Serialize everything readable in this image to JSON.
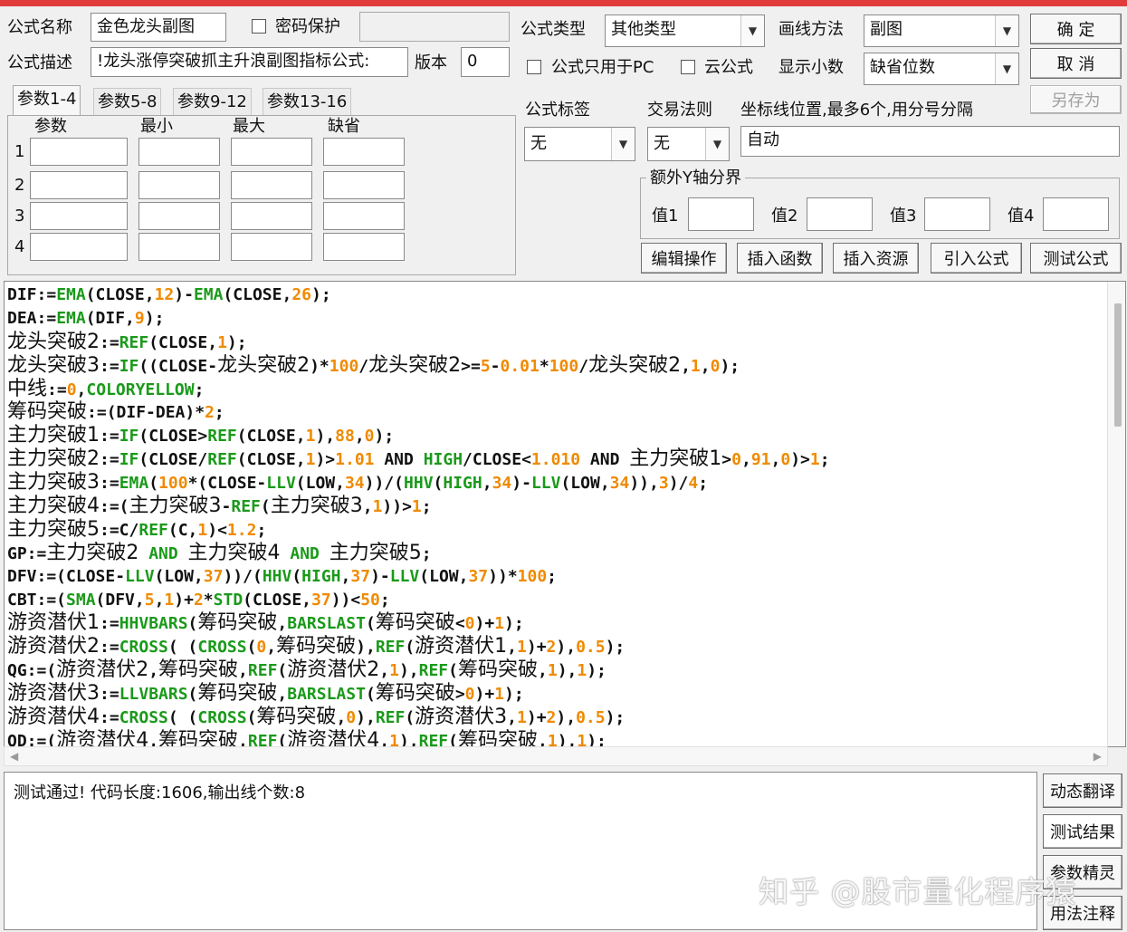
{
  "header": {
    "name_label": "公式名称",
    "name_value": "金色龙头副图",
    "password_label": "密码保护",
    "desc_label": "公式描述",
    "desc_value": "!龙头涨停突破抓主升浪副图指标公式:",
    "version_label": "版本",
    "version_value": "0",
    "type_label": "公式类型",
    "type_value": "其他类型",
    "draw_label": "画线方法",
    "draw_value": "副图",
    "pc_only_label": "公式只用于PC",
    "cloud_label": "云公式",
    "decimal_label": "显示小数",
    "decimal_value": "缺省位数"
  },
  "buttons": {
    "ok": "确  定",
    "cancel": "取  消",
    "save_as": "另存为",
    "edit": "编辑操作",
    "insert_func": "插入函数",
    "insert_res": "插入资源",
    "import": "引入公式",
    "test": "测试公式"
  },
  "tabs": [
    "参数1-4",
    "参数5-8",
    "参数9-12",
    "参数13-16"
  ],
  "params": {
    "headers": [
      "参数",
      "最小",
      "最大",
      "缺省"
    ],
    "rows": [
      "1",
      "2",
      "3",
      "4"
    ]
  },
  "meta": {
    "tag_label": "公式标签",
    "tag_value": "无",
    "rule_label": "交易法则",
    "rule_value": "无",
    "coord_label": "坐标线位置,最多6个,用分号分隔",
    "coord_value": "自动",
    "yaxis_title": "额外Y轴分界",
    "y_labels": [
      "值1",
      "值2",
      "值3",
      "值4"
    ]
  },
  "code": [
    [
      [
        "DIF:=",
        ""
      ],
      [
        "EMA",
        "fn"
      ],
      [
        "(CLOSE,",
        ""
      ],
      [
        "12",
        "num"
      ],
      [
        ")-",
        ""
      ],
      [
        "EMA",
        "fn"
      ],
      [
        "(CLOSE,",
        ""
      ],
      [
        "26",
        "num"
      ],
      [
        ");",
        ""
      ]
    ],
    [
      [
        "DEA:=",
        ""
      ],
      [
        "EMA",
        "fn"
      ],
      [
        "(DIF,",
        ""
      ],
      [
        "9",
        "num"
      ],
      [
        ");",
        ""
      ]
    ],
    [
      [
        "龙头突破2",
        "zh"
      ],
      [
        ":=",
        ""
      ],
      [
        "REF",
        "fn"
      ],
      [
        "(CLOSE,",
        ""
      ],
      [
        "1",
        "num"
      ],
      [
        ");",
        ""
      ]
    ],
    [
      [
        "龙头突破3",
        "zh"
      ],
      [
        ":=",
        ""
      ],
      [
        "IF",
        "fn"
      ],
      [
        "((CLOSE-",
        ""
      ],
      [
        "龙头突破2",
        "zh"
      ],
      [
        ")*",
        ""
      ],
      [
        "100",
        "num"
      ],
      [
        "/",
        ""
      ],
      [
        "龙头突破2",
        "zh"
      ],
      [
        ">=",
        ""
      ],
      [
        "5",
        "num"
      ],
      [
        "-",
        ""
      ],
      [
        "0.01",
        "num"
      ],
      [
        "*",
        ""
      ],
      [
        "100",
        "num"
      ],
      [
        "/",
        ""
      ],
      [
        "龙头突破2",
        "zh"
      ],
      [
        ",",
        ""
      ],
      [
        "1",
        "num"
      ],
      [
        ",",
        ""
      ],
      [
        "0",
        "num"
      ],
      [
        ");",
        ""
      ]
    ],
    [
      [
        "中线",
        "zh"
      ],
      [
        ":=",
        ""
      ],
      [
        "0",
        "num"
      ],
      [
        ",",
        ""
      ],
      [
        "COLORYELLOW",
        "fn"
      ],
      [
        ";",
        ""
      ]
    ],
    [
      [
        "筹码突破",
        "zh"
      ],
      [
        ":=(DIF-DEA)*",
        ""
      ],
      [
        "2",
        "num"
      ],
      [
        ";",
        ""
      ]
    ],
    [
      [
        "主力突破1",
        "zh"
      ],
      [
        ":=",
        ""
      ],
      [
        "IF",
        "fn"
      ],
      [
        "(CLOSE>",
        ""
      ],
      [
        "REF",
        "fn"
      ],
      [
        "(CLOSE,",
        ""
      ],
      [
        "1",
        "num"
      ],
      [
        "),",
        ""
      ],
      [
        "88",
        "num"
      ],
      [
        ",",
        ""
      ],
      [
        "0",
        "num"
      ],
      [
        ");",
        ""
      ]
    ],
    [
      [
        "主力突破2",
        "zh"
      ],
      [
        ":=",
        ""
      ],
      [
        "IF",
        "fn"
      ],
      [
        "(CLOSE/",
        ""
      ],
      [
        "REF",
        "fn"
      ],
      [
        "(CLOSE,",
        ""
      ],
      [
        "1",
        "num"
      ],
      [
        ")>",
        ""
      ],
      [
        "1.01",
        "num"
      ],
      [
        " AND ",
        ""
      ],
      [
        "HIGH",
        "fn"
      ],
      [
        "/CLOSE<",
        ""
      ],
      [
        "1.010",
        "num"
      ],
      [
        " AND ",
        ""
      ],
      [
        "主力突破1",
        "zh"
      ],
      [
        ">",
        ""
      ],
      [
        "0",
        "num"
      ],
      [
        ",",
        ""
      ],
      [
        "91",
        "num"
      ],
      [
        ",",
        ""
      ],
      [
        "0",
        "num"
      ],
      [
        ")>",
        ""
      ],
      [
        "1",
        "num"
      ],
      [
        ";",
        ""
      ]
    ],
    [
      [
        "主力突破3",
        "zh"
      ],
      [
        ":=",
        ""
      ],
      [
        "EMA",
        "fn"
      ],
      [
        "(",
        ""
      ],
      [
        "100",
        "num"
      ],
      [
        "*(CLOSE-",
        ""
      ],
      [
        "LLV",
        "fn"
      ],
      [
        "(LOW,",
        ""
      ],
      [
        "34",
        "num"
      ],
      [
        "))/(",
        ""
      ],
      [
        "HHV",
        "fn"
      ],
      [
        "(",
        ""
      ],
      [
        "HIGH",
        "fn"
      ],
      [
        ",",
        ""
      ],
      [
        "34",
        "num"
      ],
      [
        ")-",
        ""
      ],
      [
        "LLV",
        "fn"
      ],
      [
        "(LOW,",
        ""
      ],
      [
        "34",
        "num"
      ],
      [
        ")),",
        ""
      ],
      [
        "3",
        "num"
      ],
      [
        ")/",
        ""
      ],
      [
        "4",
        "num"
      ],
      [
        ";",
        ""
      ]
    ],
    [
      [
        "主力突破4",
        "zh"
      ],
      [
        ":=(",
        ""
      ],
      [
        "主力突破3",
        "zh"
      ],
      [
        "-",
        ""
      ],
      [
        "REF",
        "fn"
      ],
      [
        "(",
        ""
      ],
      [
        "主力突破3",
        "zh"
      ],
      [
        ",",
        ""
      ],
      [
        "1",
        "num"
      ],
      [
        "))>",
        ""
      ],
      [
        "1",
        "num"
      ],
      [
        ";",
        ""
      ]
    ],
    [
      [
        "主力突破5",
        "zh"
      ],
      [
        ":=C/",
        ""
      ],
      [
        "REF",
        "fn"
      ],
      [
        "(C,",
        ""
      ],
      [
        "1",
        "num"
      ],
      [
        ")<",
        ""
      ],
      [
        "1.2",
        "num"
      ],
      [
        ";",
        ""
      ]
    ],
    [
      [
        "GP:=",
        ""
      ],
      [
        "主力突破2",
        "zh"
      ],
      [
        " AND ",
        "fn"
      ],
      [
        "主力突破4",
        "zh"
      ],
      [
        " AND ",
        "fn"
      ],
      [
        "主力突破5",
        "zh"
      ],
      [
        ";",
        ""
      ]
    ],
    [
      [
        "DFV:=(",
        ""
      ],
      [
        "CLOSE-",
        ""
      ],
      [
        "LLV",
        "fn"
      ],
      [
        "(LOW,",
        ""
      ],
      [
        "37",
        "num"
      ],
      [
        "))/(",
        ""
      ],
      [
        "HHV",
        "fn"
      ],
      [
        "(",
        ""
      ],
      [
        "HIGH",
        "fn"
      ],
      [
        ",",
        ""
      ],
      [
        "37",
        "num"
      ],
      [
        ")-",
        ""
      ],
      [
        "LLV",
        "fn"
      ],
      [
        "(LOW,",
        ""
      ],
      [
        "37",
        "num"
      ],
      [
        "))*",
        ""
      ],
      [
        "100",
        "num"
      ],
      [
        ";",
        ""
      ]
    ],
    [
      [
        "CBT:=(",
        ""
      ],
      [
        "SMA",
        "fn"
      ],
      [
        "(DFV,",
        ""
      ],
      [
        "5",
        "num"
      ],
      [
        ",",
        ""
      ],
      [
        "1",
        "num"
      ],
      [
        ")+",
        ""
      ],
      [
        "2",
        "num"
      ],
      [
        "*",
        ""
      ],
      [
        "STD",
        "fn"
      ],
      [
        "(CLOSE,",
        ""
      ],
      [
        "37",
        "num"
      ],
      [
        "))<",
        ""
      ],
      [
        "50",
        "num"
      ],
      [
        ";",
        ""
      ]
    ],
    [
      [
        "游资潜伏1",
        "zh"
      ],
      [
        ":=",
        ""
      ],
      [
        "HHVBARS",
        "fn"
      ],
      [
        "(",
        ""
      ],
      [
        "筹码突破",
        "zh"
      ],
      [
        ",",
        ""
      ],
      [
        "BARSLAST",
        "fn"
      ],
      [
        "(",
        ""
      ],
      [
        "筹码突破",
        "zh"
      ],
      [
        "<",
        ""
      ],
      [
        "0",
        "num"
      ],
      [
        ")+",
        ""
      ],
      [
        "1",
        "num"
      ],
      [
        ");",
        ""
      ]
    ],
    [
      [
        "游资潜伏2",
        "zh"
      ],
      [
        ":=",
        ""
      ],
      [
        "CROSS",
        "fn"
      ],
      [
        "( (",
        ""
      ],
      [
        "CROSS",
        "fn"
      ],
      [
        "(",
        ""
      ],
      [
        "0",
        "num"
      ],
      [
        ",",
        ""
      ],
      [
        "筹码突破",
        "zh"
      ],
      [
        "),",
        ""
      ],
      [
        "REF",
        "fn"
      ],
      [
        "(",
        ""
      ],
      [
        "游资潜伏1",
        "zh"
      ],
      [
        ",",
        ""
      ],
      [
        "1",
        "num"
      ],
      [
        ")+",
        ""
      ],
      [
        "2",
        "num"
      ],
      [
        "),",
        ""
      ],
      [
        "0.5",
        "num"
      ],
      [
        ");",
        ""
      ]
    ],
    [
      [
        "QG:=(",
        ""
      ],
      [
        "游资潜伏2",
        "zh"
      ],
      [
        ",",
        ""
      ],
      [
        "筹码突破",
        "zh"
      ],
      [
        ",",
        ""
      ],
      [
        "REF",
        "fn"
      ],
      [
        "(",
        ""
      ],
      [
        "游资潜伏2",
        "zh"
      ],
      [
        ",",
        ""
      ],
      [
        "1",
        "num"
      ],
      [
        "),",
        ""
      ],
      [
        "REF",
        "fn"
      ],
      [
        "(",
        ""
      ],
      [
        "筹码突破",
        "zh"
      ],
      [
        ",",
        ""
      ],
      [
        "1",
        "num"
      ],
      [
        "),",
        ""
      ],
      [
        "1",
        "num"
      ],
      [
        ");",
        ""
      ]
    ],
    [
      [
        "游资潜伏3",
        "zh"
      ],
      [
        ":=",
        ""
      ],
      [
        "LLVBARS",
        "fn"
      ],
      [
        "(",
        ""
      ],
      [
        "筹码突破",
        "zh"
      ],
      [
        ",",
        ""
      ],
      [
        "BARSLAST",
        "fn"
      ],
      [
        "(",
        ""
      ],
      [
        "筹码突破",
        "zh"
      ],
      [
        ">",
        ""
      ],
      [
        "0",
        "num"
      ],
      [
        ")+",
        ""
      ],
      [
        "1",
        "num"
      ],
      [
        ");",
        ""
      ]
    ],
    [
      [
        "游资潜伏4",
        "zh"
      ],
      [
        ":=",
        ""
      ],
      [
        "CROSS",
        "fn"
      ],
      [
        "( (",
        ""
      ],
      [
        "CROSS",
        "fn"
      ],
      [
        "(",
        ""
      ],
      [
        "筹码突破",
        "zh"
      ],
      [
        ",",
        ""
      ],
      [
        "0",
        "num"
      ],
      [
        "),",
        ""
      ],
      [
        "REF",
        "fn"
      ],
      [
        "(",
        ""
      ],
      [
        "游资潜伏3",
        "zh"
      ],
      [
        ",",
        ""
      ],
      [
        "1",
        "num"
      ],
      [
        ")+",
        ""
      ],
      [
        "2",
        "num"
      ],
      [
        "),",
        ""
      ],
      [
        "0.5",
        "num"
      ],
      [
        ");",
        ""
      ]
    ],
    [
      [
        "QD:=(",
        ""
      ],
      [
        "游资潜伏4",
        "zh"
      ],
      [
        ",",
        ""
      ],
      [
        "筹码突破",
        "zh"
      ],
      [
        ",",
        ""
      ],
      [
        "REF",
        "fn"
      ],
      [
        "(",
        ""
      ],
      [
        "游资潜伏4",
        "zh"
      ],
      [
        ",",
        ""
      ],
      [
        "1",
        "num"
      ],
      [
        "),",
        ""
      ],
      [
        "REF",
        "fn"
      ],
      [
        "(",
        ""
      ],
      [
        "筹码突破",
        "zh"
      ],
      [
        ",",
        ""
      ],
      [
        "1",
        "num"
      ],
      [
        "),",
        ""
      ],
      [
        "1",
        "num"
      ],
      [
        ");",
        ""
      ]
    ]
  ],
  "result_text": "测试通过! 代码长度:1606,输出线个数:8",
  "side_buttons": [
    "动态翻译",
    "测试结果",
    "参数精灵",
    "用法注释"
  ],
  "watermark": "知乎 @股市量化程序猿",
  "colors": {
    "function": "#1a9a1a",
    "number": "#f08a00",
    "title_bar": "#e23b3b"
  }
}
